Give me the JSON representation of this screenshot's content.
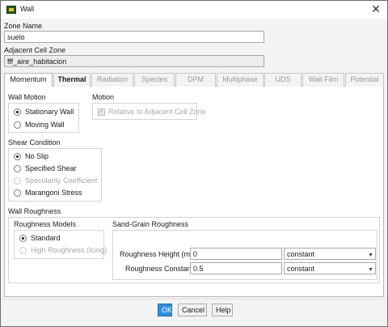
{
  "window": {
    "title": "Wall",
    "close_glyph": "✕"
  },
  "zone": {
    "label": "Zone Name",
    "value": "suelo"
  },
  "adjacent": {
    "label": "Adjacent Cell Zone",
    "value": "fff_aire_habitacion"
  },
  "tabs": [
    {
      "label": "Momentum",
      "state": "active"
    },
    {
      "label": "Thermal",
      "state": "enabled"
    },
    {
      "label": "Radiation",
      "state": "disabled"
    },
    {
      "label": "Species",
      "state": "disabled"
    },
    {
      "label": "DPM",
      "state": "disabled"
    },
    {
      "label": "Multiphase",
      "state": "disabled"
    },
    {
      "label": "UDS",
      "state": "disabled"
    },
    {
      "label": "Wall Film",
      "state": "disabled"
    },
    {
      "label": "Potential",
      "state": "disabled"
    }
  ],
  "wall_motion": {
    "label": "Wall Motion",
    "options": [
      {
        "label": "Stationary Wall",
        "selected": true
      },
      {
        "label": "Moving Wall",
        "selected": false
      }
    ]
  },
  "motion": {
    "label": "Motion",
    "relative_label": "Relative to Adjacent Cell Zone",
    "relative_checked": true
  },
  "shear": {
    "label": "Shear Condition",
    "options": [
      {
        "label": "No Slip",
        "selected": true,
        "enabled": true
      },
      {
        "label": "Specified Shear",
        "selected": false,
        "enabled": true
      },
      {
        "label": "Specularity Coefficient",
        "selected": false,
        "enabled": false
      },
      {
        "label": "Marangoni Stress",
        "selected": false,
        "enabled": true
      }
    ]
  },
  "roughness": {
    "label": "Wall Roughness",
    "models_label": "Roughness Models",
    "models": [
      {
        "label": "Standard",
        "selected": true,
        "enabled": true
      },
      {
        "label": "High Roughness (Icing)",
        "selected": false,
        "enabled": false
      }
    ],
    "sand_label": "Sand-Grain Roughness",
    "height": {
      "label": "Roughness Height (m)",
      "value": "0",
      "method": "constant"
    },
    "constant": {
      "label": "Roughness Constant",
      "value": "0.5",
      "method": "constant"
    }
  },
  "buttons": {
    "ok": "OK",
    "cancel": "Cancel",
    "help": "Help"
  },
  "colors": {
    "accent": "#2f8fde"
  },
  "icons": {
    "app": "fluent-app-icon",
    "close": "close-icon",
    "dropdown": "chevron-down-icon"
  }
}
